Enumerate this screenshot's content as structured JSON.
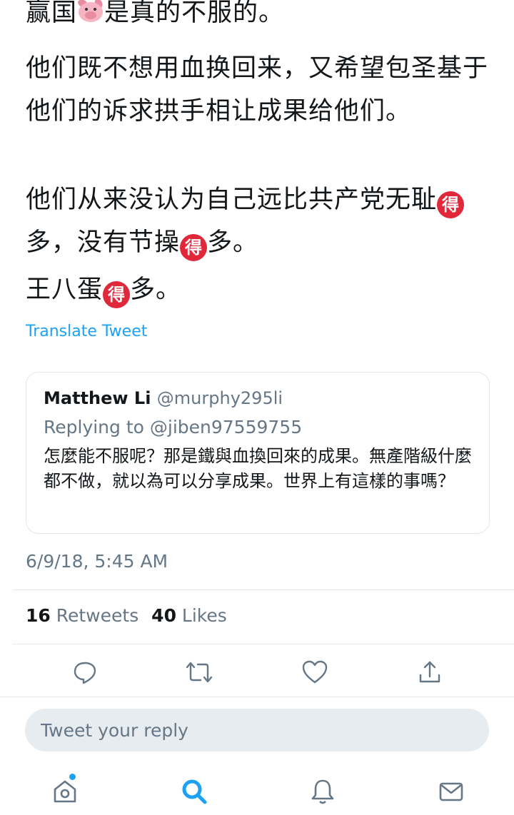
{
  "tweet": {
    "p1_before": "赢国",
    "p1_emoji": "pig-face-emoji",
    "p1_after": "是真的不服的。",
    "p2": "他们既不想用血换回来，又希望包圣基于他们的诉求拱手相让成果给他们。",
    "p3_a": "他们从来没认为自己远比共产党无耻",
    "p3_b": "多，没有节操",
    "p3_c": "多。",
    "p4_a": "王八蛋",
    "p4_b": "多。",
    "de_emoji_char": "得",
    "translate_label": "Translate Tweet",
    "timestamp": "6/9/18, 5:45 AM"
  },
  "quote": {
    "name": "Matthew Li",
    "handle": "@murphy295li",
    "replying_to": "Replying to @jiben97559755",
    "text": "怎麼能不服呢？那是鐵與血換回來的成果。無產階級什麼都不做，就以為可以分享成果。世界上有這樣的事嗎？"
  },
  "stats": {
    "retweets_count": "16",
    "retweets_label": "Retweets",
    "likes_count": "40",
    "likes_label": "Likes"
  },
  "actions": [
    "reply-icon",
    "retweet-icon",
    "like-icon",
    "share-icon"
  ],
  "reply_box": {
    "placeholder": "Tweet your reply"
  },
  "tabbar": {
    "items": [
      "home-icon",
      "search-icon",
      "notifications-icon",
      "messages-icon"
    ],
    "active": "search-icon",
    "accent": "#1da1f2",
    "icon_color": "#657786"
  }
}
